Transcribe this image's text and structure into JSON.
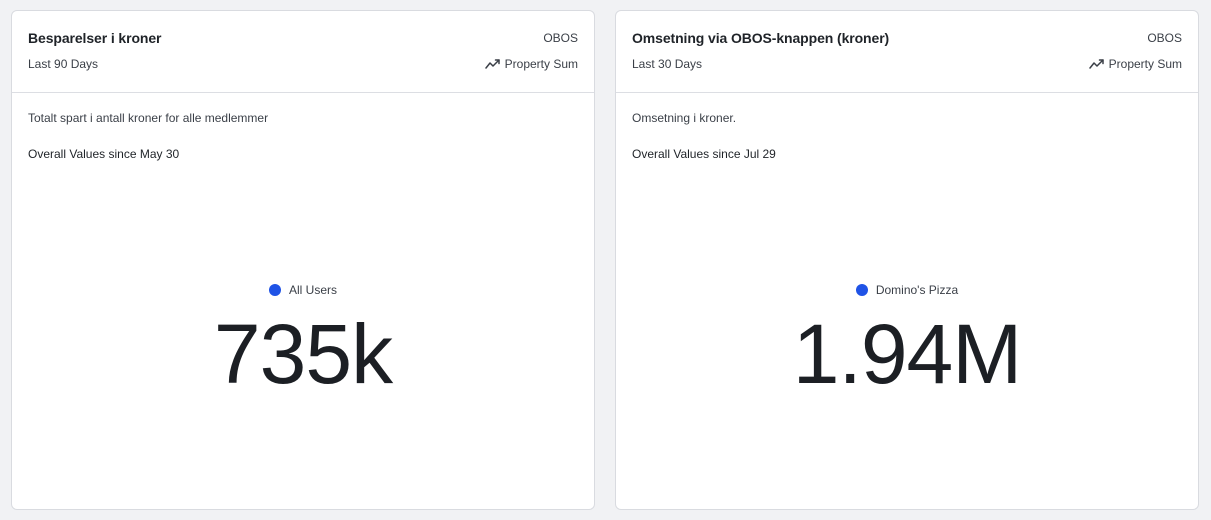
{
  "colors": {
    "series_dot": "#1f53e6",
    "background": "#f1f2f4",
    "card_border": "#d9dbe0"
  },
  "cards": [
    {
      "title": "Besparelser i kroner",
      "org": "OBOS",
      "range": "Last 90 Days",
      "metric_icon": "trend-line-icon",
      "metric": "Property Sum",
      "description": "Totalt spart i antall kroner for alle medlemmer",
      "since": "Overall Values since May 30",
      "series_name": "All Users",
      "value": "735k"
    },
    {
      "title": "Omsetning via OBOS-knappen (kroner)",
      "org": "OBOS",
      "range": "Last 30 Days",
      "metric_icon": "trend-line-icon",
      "metric": "Property Sum",
      "description": "Omsetning i kroner.",
      "since": "Overall Values since Jul 29",
      "series_name": "Domino's Pizza",
      "value": "1.94M"
    }
  ]
}
